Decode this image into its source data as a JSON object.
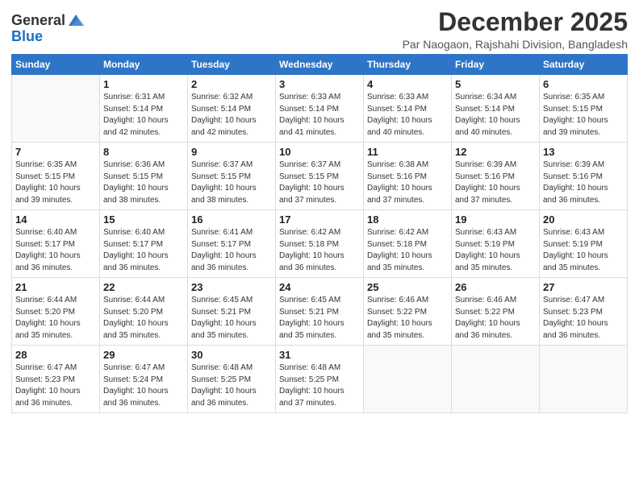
{
  "logo": {
    "general": "General",
    "blue": "Blue"
  },
  "title": "December 2025",
  "location": "Par Naogaon, Rajshahi Division, Bangladesh",
  "days_of_week": [
    "Sunday",
    "Monday",
    "Tuesday",
    "Wednesday",
    "Thursday",
    "Friday",
    "Saturday"
  ],
  "weeks": [
    [
      {
        "day": "",
        "sunrise": "",
        "sunset": "",
        "daylight": ""
      },
      {
        "day": "1",
        "sunrise": "Sunrise: 6:31 AM",
        "sunset": "Sunset: 5:14 PM",
        "daylight": "Daylight: 10 hours and 42 minutes."
      },
      {
        "day": "2",
        "sunrise": "Sunrise: 6:32 AM",
        "sunset": "Sunset: 5:14 PM",
        "daylight": "Daylight: 10 hours and 42 minutes."
      },
      {
        "day": "3",
        "sunrise": "Sunrise: 6:33 AM",
        "sunset": "Sunset: 5:14 PM",
        "daylight": "Daylight: 10 hours and 41 minutes."
      },
      {
        "day": "4",
        "sunrise": "Sunrise: 6:33 AM",
        "sunset": "Sunset: 5:14 PM",
        "daylight": "Daylight: 10 hours and 40 minutes."
      },
      {
        "day": "5",
        "sunrise": "Sunrise: 6:34 AM",
        "sunset": "Sunset: 5:14 PM",
        "daylight": "Daylight: 10 hours and 40 minutes."
      },
      {
        "day": "6",
        "sunrise": "Sunrise: 6:35 AM",
        "sunset": "Sunset: 5:15 PM",
        "daylight": "Daylight: 10 hours and 39 minutes."
      }
    ],
    [
      {
        "day": "7",
        "sunrise": "Sunrise: 6:35 AM",
        "sunset": "Sunset: 5:15 PM",
        "daylight": "Daylight: 10 hours and 39 minutes."
      },
      {
        "day": "8",
        "sunrise": "Sunrise: 6:36 AM",
        "sunset": "Sunset: 5:15 PM",
        "daylight": "Daylight: 10 hours and 38 minutes."
      },
      {
        "day": "9",
        "sunrise": "Sunrise: 6:37 AM",
        "sunset": "Sunset: 5:15 PM",
        "daylight": "Daylight: 10 hours and 38 minutes."
      },
      {
        "day": "10",
        "sunrise": "Sunrise: 6:37 AM",
        "sunset": "Sunset: 5:15 PM",
        "daylight": "Daylight: 10 hours and 37 minutes."
      },
      {
        "day": "11",
        "sunrise": "Sunrise: 6:38 AM",
        "sunset": "Sunset: 5:16 PM",
        "daylight": "Daylight: 10 hours and 37 minutes."
      },
      {
        "day": "12",
        "sunrise": "Sunrise: 6:39 AM",
        "sunset": "Sunset: 5:16 PM",
        "daylight": "Daylight: 10 hours and 37 minutes."
      },
      {
        "day": "13",
        "sunrise": "Sunrise: 6:39 AM",
        "sunset": "Sunset: 5:16 PM",
        "daylight": "Daylight: 10 hours and 36 minutes."
      }
    ],
    [
      {
        "day": "14",
        "sunrise": "Sunrise: 6:40 AM",
        "sunset": "Sunset: 5:17 PM",
        "daylight": "Daylight: 10 hours and 36 minutes."
      },
      {
        "day": "15",
        "sunrise": "Sunrise: 6:40 AM",
        "sunset": "Sunset: 5:17 PM",
        "daylight": "Daylight: 10 hours and 36 minutes."
      },
      {
        "day": "16",
        "sunrise": "Sunrise: 6:41 AM",
        "sunset": "Sunset: 5:17 PM",
        "daylight": "Daylight: 10 hours and 36 minutes."
      },
      {
        "day": "17",
        "sunrise": "Sunrise: 6:42 AM",
        "sunset": "Sunset: 5:18 PM",
        "daylight": "Daylight: 10 hours and 36 minutes."
      },
      {
        "day": "18",
        "sunrise": "Sunrise: 6:42 AM",
        "sunset": "Sunset: 5:18 PM",
        "daylight": "Daylight: 10 hours and 35 minutes."
      },
      {
        "day": "19",
        "sunrise": "Sunrise: 6:43 AM",
        "sunset": "Sunset: 5:19 PM",
        "daylight": "Daylight: 10 hours and 35 minutes."
      },
      {
        "day": "20",
        "sunrise": "Sunrise: 6:43 AM",
        "sunset": "Sunset: 5:19 PM",
        "daylight": "Daylight: 10 hours and 35 minutes."
      }
    ],
    [
      {
        "day": "21",
        "sunrise": "Sunrise: 6:44 AM",
        "sunset": "Sunset: 5:20 PM",
        "daylight": "Daylight: 10 hours and 35 minutes."
      },
      {
        "day": "22",
        "sunrise": "Sunrise: 6:44 AM",
        "sunset": "Sunset: 5:20 PM",
        "daylight": "Daylight: 10 hours and 35 minutes."
      },
      {
        "day": "23",
        "sunrise": "Sunrise: 6:45 AM",
        "sunset": "Sunset: 5:21 PM",
        "daylight": "Daylight: 10 hours and 35 minutes."
      },
      {
        "day": "24",
        "sunrise": "Sunrise: 6:45 AM",
        "sunset": "Sunset: 5:21 PM",
        "daylight": "Daylight: 10 hours and 35 minutes."
      },
      {
        "day": "25",
        "sunrise": "Sunrise: 6:46 AM",
        "sunset": "Sunset: 5:22 PM",
        "daylight": "Daylight: 10 hours and 35 minutes."
      },
      {
        "day": "26",
        "sunrise": "Sunrise: 6:46 AM",
        "sunset": "Sunset: 5:22 PM",
        "daylight": "Daylight: 10 hours and 36 minutes."
      },
      {
        "day": "27",
        "sunrise": "Sunrise: 6:47 AM",
        "sunset": "Sunset: 5:23 PM",
        "daylight": "Daylight: 10 hours and 36 minutes."
      }
    ],
    [
      {
        "day": "28",
        "sunrise": "Sunrise: 6:47 AM",
        "sunset": "Sunset: 5:23 PM",
        "daylight": "Daylight: 10 hours and 36 minutes."
      },
      {
        "day": "29",
        "sunrise": "Sunrise: 6:47 AM",
        "sunset": "Sunset: 5:24 PM",
        "daylight": "Daylight: 10 hours and 36 minutes."
      },
      {
        "day": "30",
        "sunrise": "Sunrise: 6:48 AM",
        "sunset": "Sunset: 5:25 PM",
        "daylight": "Daylight: 10 hours and 36 minutes."
      },
      {
        "day": "31",
        "sunrise": "Sunrise: 6:48 AM",
        "sunset": "Sunset: 5:25 PM",
        "daylight": "Daylight: 10 hours and 37 minutes."
      },
      {
        "day": "",
        "sunrise": "",
        "sunset": "",
        "daylight": ""
      },
      {
        "day": "",
        "sunrise": "",
        "sunset": "",
        "daylight": ""
      },
      {
        "day": "",
        "sunrise": "",
        "sunset": "",
        "daylight": ""
      }
    ]
  ]
}
